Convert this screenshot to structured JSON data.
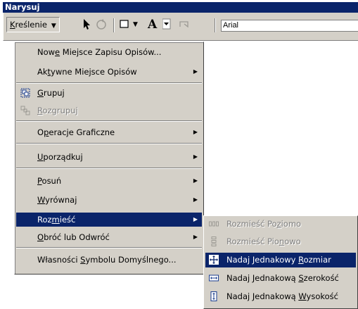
{
  "window": {
    "title": "Narysuj"
  },
  "toolbar": {
    "draw_button_label_prefix": "K",
    "draw_button_label_rest": "reślenie",
    "font_name": "Arial"
  },
  "main_menu": {
    "items": [
      {
        "label_a": "Now",
        "label_u": "e",
        "label_b": " Miejsce Zapisu Opisów..."
      },
      {
        "label_a": "Ak",
        "label_u": "t",
        "label_b": "ywne Miejsce Opisów"
      },
      {
        "label_a": "",
        "label_u": "G",
        "label_b": "rupuj"
      },
      {
        "label_a": "",
        "label_u": "R",
        "label_b": "ozgrupuj"
      },
      {
        "label_a": "O",
        "label_u": "p",
        "label_b": "eracje Graficzne"
      },
      {
        "label_a": "",
        "label_u": "U",
        "label_b": "porządkuj"
      },
      {
        "label_a": "",
        "label_u": "P",
        "label_b": "osuń"
      },
      {
        "label_a": "",
        "label_u": "W",
        "label_b": "yrównaj"
      },
      {
        "label_a": "Roz",
        "label_u": "m",
        "label_b": "ieść"
      },
      {
        "label_a": "",
        "label_u": "O",
        "label_b": "bróć lub Odwróć"
      },
      {
        "label_a": "Własności ",
        "label_u": "S",
        "label_b": "ymbolu Domyślnego..."
      }
    ]
  },
  "sub_menu": {
    "items": [
      {
        "label_a": "Rozmieść Po",
        "label_u": "z",
        "label_b": "iomo"
      },
      {
        "label_a": "Rozmieść Pio",
        "label_u": "n",
        "label_b": "owo"
      },
      {
        "label_a": "Nadaj Jednakowy ",
        "label_u": "R",
        "label_b": "ozmiar"
      },
      {
        "label_a": "Nadaj Jednakową ",
        "label_u": "S",
        "label_b": "zerokość"
      },
      {
        "label_a": "Nadaj Jednakową ",
        "label_u": "W",
        "label_b": "ysokość"
      }
    ]
  },
  "colors": {
    "highlight": "#0a246a",
    "face": "#d4d0c8",
    "title": "#0a246a"
  }
}
